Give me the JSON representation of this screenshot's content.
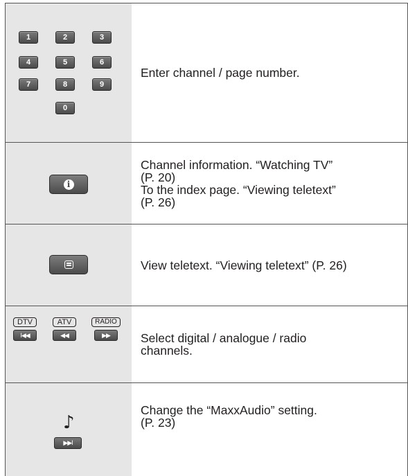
{
  "rows": [
    {
      "keys": [
        "1",
        "2",
        "3",
        "4",
        "5",
        "6",
        "7",
        "8",
        "9",
        "0"
      ],
      "lines": [
        "Enter channel / page number."
      ]
    },
    {
      "key_icon": "info-icon",
      "key_glyph": "i",
      "lines": [
        "Channel information. “Watching TV”",
        "(P. 20)",
        "To the index page. “Viewing teletext”",
        "(P. 26)"
      ]
    },
    {
      "key_icon": "teletext-icon",
      "lines": [
        "View teletext. “Viewing teletext” (P. 26)"
      ]
    },
    {
      "source_labels": [
        "DTV",
        "ATV",
        "RADIO"
      ],
      "media_keys": [
        "I◀◀",
        "◀◀",
        "▶▶"
      ],
      "lines": [
        "Select digital / analogue / radio",
        "channels."
      ]
    },
    {
      "note_glyph": "♪",
      "key_glyph": "▶▶I",
      "lines": [
        "Change the “MaxxAudio” setting.",
        "(P. 23)"
      ]
    }
  ]
}
